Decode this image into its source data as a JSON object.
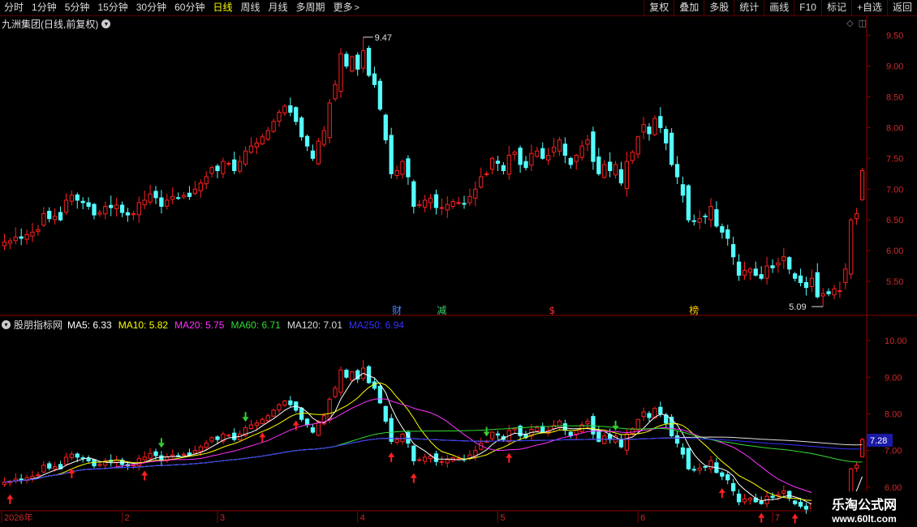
{
  "toolbar": {
    "periods": [
      "分时",
      "1分钟",
      "5分钟",
      "15分钟",
      "30分钟",
      "60分钟",
      "日线",
      "周线",
      "月线",
      "多周期"
    ],
    "active_period": "日线",
    "more_label": "更多",
    "right_buttons": [
      "复权",
      "叠加",
      "多股",
      "统计",
      "画线",
      "F10",
      "标记",
      "+自选",
      "返回"
    ]
  },
  "main_panel": {
    "title": "九洲集团(日线,前复权)",
    "dropdown_icon": "chevron-down-icon",
    "top_icons": [
      "diamond-icon",
      "square-icon"
    ],
    "price_axis": [
      "9.50",
      "9.00",
      "8.50",
      "8.00",
      "7.50",
      "7.00",
      "6.50",
      "6.00",
      "5.50"
    ],
    "high_label": "9.47",
    "low_label": "5.09",
    "event_markers": [
      {
        "text": "财",
        "color": "#4a86ff"
      },
      {
        "text": "减",
        "color": "#3bd16f"
      },
      {
        "text": "$",
        "color": "#ff3030"
      },
      {
        "text": "榜",
        "color": "#ffcc00"
      }
    ]
  },
  "sub_panel": {
    "title": "股朋指标网",
    "ma_values": [
      {
        "label": "MA5: 6.33",
        "color": "#ffffff"
      },
      {
        "label": "MA10: 5.82",
        "color": "#ffff00"
      },
      {
        "label": "MA20: 5.75",
        "color": "#ff33ff"
      },
      {
        "label": "MA60: 6.71",
        "color": "#33dd33"
      },
      {
        "label": "MA120: 7.01",
        "color": "#dddddd"
      },
      {
        "label": "MA250: 6.94",
        "color": "#3333ff"
      }
    ],
    "price_axis": [
      "10.00",
      "9.00",
      "8.00",
      "7.00",
      "6.00"
    ],
    "current_value": "7.28"
  },
  "time_axis": {
    "labels": [
      "2026年",
      "2",
      "3",
      "4",
      "5",
      "6",
      "7"
    ]
  },
  "watermark": {
    "name": "乐淘公式网",
    "url": "www.60lt.com"
  },
  "colors": {
    "up": "#ff2020",
    "down": "#54ffff",
    "axis": "#8b0000",
    "axis_text": "#cc2a2a",
    "active": "#ffff00"
  },
  "chart_data": {
    "type": "candlestick",
    "title": "九洲集团(日线,前复权)",
    "ylim": [
      5.0,
      9.6
    ],
    "months": [
      "2026年",
      "2",
      "3",
      "4",
      "5",
      "6",
      "7"
    ],
    "close": [
      6.14,
      6.16,
      6.22,
      6.2,
      6.26,
      6.3,
      6.34,
      6.6,
      6.52,
      6.56,
      6.5,
      6.82,
      6.9,
      6.82,
      6.78,
      6.72,
      6.58,
      6.62,
      6.72,
      6.7,
      6.74,
      6.62,
      6.58,
      6.6,
      6.78,
      6.82,
      6.92,
      6.86,
      6.72,
      6.82,
      6.88,
      6.86,
      6.9,
      6.88,
      7.0,
      7.1,
      7.2,
      7.35,
      7.3,
      7.45,
      7.42,
      7.3,
      7.45,
      7.62,
      7.7,
      7.75,
      7.85,
      7.95,
      8.1,
      8.25,
      8.35,
      8.25,
      8.1,
      7.85,
      7.7,
      7.5,
      7.78,
      7.95,
      8.4,
      8.7,
      9.2,
      9.0,
      9.15,
      8.95,
      9.25,
      8.85,
      8.7,
      8.3,
      7.8,
      7.25,
      7.3,
      7.45,
      7.2,
      6.72,
      6.75,
      6.82,
      6.85,
      6.7,
      6.7,
      6.75,
      6.8,
      6.78,
      6.76,
      6.88,
      7.0,
      7.2,
      7.25,
      7.5,
      7.42,
      7.3,
      7.55,
      7.6,
      7.4,
      7.35,
      7.58,
      7.62,
      7.5,
      7.55,
      7.68,
      7.8,
      7.55,
      7.4,
      7.55,
      7.7,
      7.8,
      7.45,
      7.25,
      7.4,
      7.3,
      7.4,
      7.1,
      7.45,
      7.6,
      7.85,
      8.05,
      7.9,
      8.15,
      8.0,
      7.75,
      7.4,
      7.2,
      6.9,
      6.5,
      6.48,
      6.52,
      6.55,
      6.72,
      6.4,
      6.3,
      6.2,
      5.9,
      5.6,
      5.68,
      5.7,
      5.6,
      5.55,
      5.75,
      5.72,
      5.8,
      5.9,
      5.7,
      5.55,
      5.48,
      5.4,
      5.55,
      5.25,
      5.3,
      5.3,
      5.38,
      5.35,
      5.7,
      6.5,
      6.6,
      7.3
    ],
    "MA5": 6.33,
    "MA10": 5.82,
    "MA20": 5.75,
    "MA60": 6.71,
    "MA120": 7.01,
    "MA250": 6.94
  }
}
